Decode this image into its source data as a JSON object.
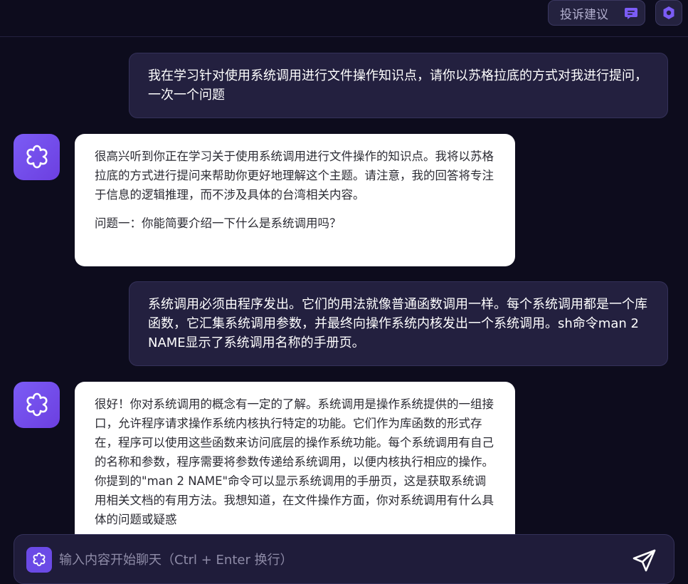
{
  "topbar": {
    "feedback_label": "投诉建议",
    "feedback_icon": "chat-bubble-icon",
    "settings_icon": "hexagon-settings-icon"
  },
  "messages": [
    {
      "role": "user",
      "text": "我在学习针对使用系统调用进行文件操作知识点，请你以苏格拉底的方式对我进行提问，一次一个问题"
    },
    {
      "role": "assistant",
      "avatar_icon": "flower-logo-icon",
      "paragraphs": [
        "很高兴听到你正在学习关于使用系统调用进行文件操作的知识点。我将以苏格拉底的方式进行提问来帮助你更好地理解这个主题。请注意，我的回答将专注于信息的逻辑推理，而不涉及具体的台湾相关内容。",
        "问题一：你能简要介绍一下什么是系统调用吗？"
      ]
    },
    {
      "role": "user",
      "text": "系统调用必须由程序发出。它们的用法就像普通函数调用一样。每个系统调用都是一个库函数，它汇集系统调用参数，并最终向操作系统内核发出一个系统调用。sh命令man 2 NAME显示了系统调用名称的手册页。"
    },
    {
      "role": "assistant",
      "avatar_icon": "flower-logo-icon",
      "paragraphs": [
        "很好！你对系统调用的概念有一定的了解。系统调用是操作系统提供的一组接口，允许程序请求操作系统内核执行特定的功能。它们作为库函数的形式存在，程序可以使用这些函数来访问底层的操作系统功能。每个系统调用有自己的名称和参数，程序需要将参数传递给系统调用，以便内核执行相应的操作。你提到的\"man 2 NAME\"命令可以显示系统调用的手册页，这是获取系统调用相关文档的有用方法。我想知道，在文件操作方面，你对系统调用有什么具体的问题或疑惑"
      ]
    }
  ],
  "input": {
    "placeholder": "输入内容开始聊天（Ctrl + Enter 换行）",
    "value": "",
    "logo_icon": "flower-logo-icon",
    "send_icon": "paper-plane-send-icon"
  },
  "colors": {
    "background": "#0d0c1d",
    "user_bubble": "#23203f",
    "assistant_bubble": "#ffffff",
    "accent": "#7b5cf5"
  }
}
